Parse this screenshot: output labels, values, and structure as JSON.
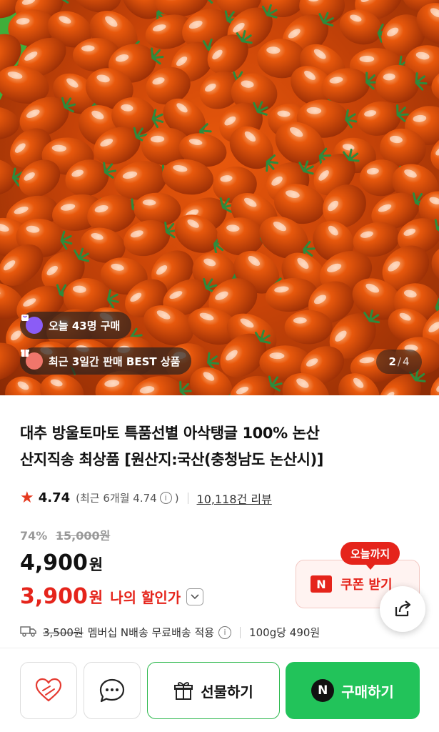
{
  "hero": {
    "badge_today": "오늘 43명 구매",
    "badge_best": "최근 3일간 판매 BEST 상품",
    "pager_current": "2",
    "pager_sep": "/",
    "pager_total": "4",
    "colors": {
      "tomato": "#e8580c",
      "stem": "#2e8b3c",
      "basket": "#3fae3a"
    }
  },
  "product": {
    "title_line1": "대추 방울토마토 특품선별 아삭탱글 100% 논산",
    "title_line2": "산지직송 최상품 [원산지:국산(충청남도 논산시)]",
    "rating_score": "4.74",
    "rating_recent_open": "(최근 6개월 4.74",
    "rating_recent_close": ")",
    "review_count": "10,118건 리뷰",
    "discount_rate": "74%",
    "original_price": "15,000원",
    "price": "4,900",
    "price_unit": "원",
    "my_price": "3,900",
    "my_price_unit": "원",
    "my_price_label": "나의 할인가"
  },
  "coupon": {
    "tag": "오늘까지",
    "logo": "N",
    "label": "쿠폰 받기"
  },
  "shipping": {
    "fee": "3,500원",
    "text": "멤버십 N배송 무료배송 적용",
    "unit_price": "100g당 490원"
  },
  "bottom_bar": {
    "gift_label": "선물하기",
    "buy_logo": "N",
    "buy_label": "구매하기"
  },
  "colors": {
    "accent_red": "#e5241b",
    "buy_green": "#22c35a",
    "gift_border": "#2db84d",
    "star": "#e5391f"
  }
}
